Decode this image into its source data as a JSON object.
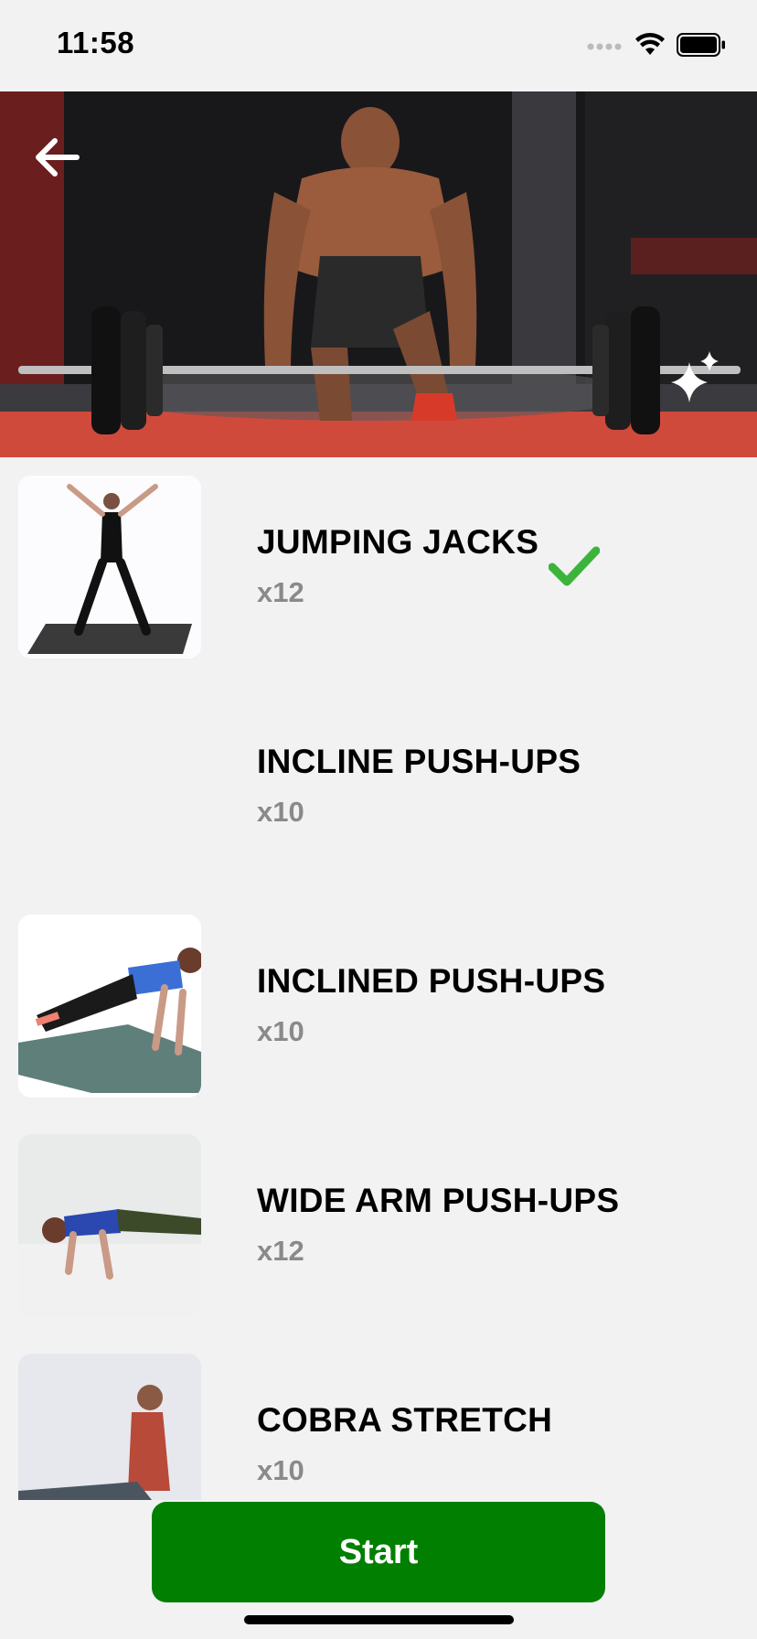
{
  "status_bar": {
    "time": "11:58"
  },
  "hero": {
    "back_icon": "arrow-left-icon",
    "sparkle_icon": "sparkle-icon"
  },
  "exercises": [
    {
      "name": "JUMPING JACKS",
      "count": "x12",
      "completed": true
    },
    {
      "name": "INCLINE PUSH-UPS",
      "count": "x10",
      "completed": false
    },
    {
      "name": "INCLINED PUSH-UPS",
      "count": "x10",
      "completed": false
    },
    {
      "name": "WIDE ARM PUSH-UPS",
      "count": "x12",
      "completed": false
    },
    {
      "name": "COBRA STRETCH",
      "count": "x10",
      "completed": false
    }
  ],
  "start_button": {
    "label": "Start"
  },
  "colors": {
    "accent": "#007f00",
    "check": "#3cb43c",
    "background": "#f2f2f2"
  }
}
